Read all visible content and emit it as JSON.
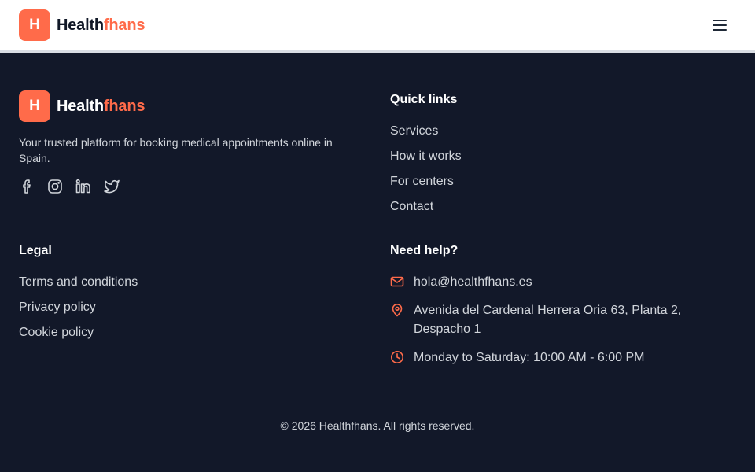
{
  "brand": {
    "logo_letter": "H",
    "name_part1": "Health",
    "name_part2": "fhans",
    "accent_color": "#ff6b4a"
  },
  "header": {
    "menu_icon": "hamburger-menu-icon"
  },
  "footer": {
    "tagline": "Your trusted platform for booking medical appointments online in Spain.",
    "socials": [
      "facebook-icon",
      "instagram-icon",
      "linkedin-icon",
      "twitter-icon"
    ],
    "quick_links": {
      "title": "Quick links",
      "items": [
        "Services",
        "How it works",
        "For centers",
        "Contact"
      ]
    },
    "legal": {
      "title": "Legal",
      "items": [
        "Terms and conditions",
        "Privacy policy",
        "Cookie policy"
      ]
    },
    "help": {
      "title": "Need help?",
      "email": "hola@healthfhans.es",
      "address": "Avenida del Cardenal Herrera Oria 63, Planta 2, Despacho 1",
      "hours": "Monday to Saturday: 10:00 AM - 6:00 PM"
    },
    "copyright": "© 2026 Healthfhans. All rights reserved."
  }
}
